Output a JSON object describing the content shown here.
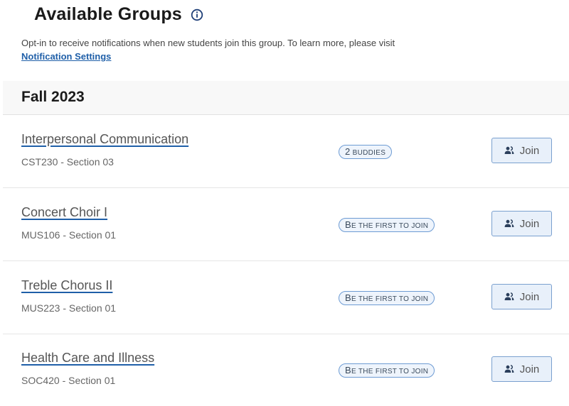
{
  "header": {
    "title": "Available Groups",
    "info_icon": "info-circle-icon",
    "description": "Opt-in to receive notifications when new students join this group. To learn more, please visit",
    "link_label": "Notification Settings"
  },
  "term": {
    "title": "Fall 2023"
  },
  "groups": [
    {
      "name": "Interpersonal Communication",
      "code": "CST230 - Section 03",
      "badge": "2 BUDDIES",
      "badge_type": "buddies",
      "action": "Join",
      "action_icon": "people-icon"
    },
    {
      "name": "Concert Choir I",
      "code": "MUS106 - Section 01",
      "badge": "BE THE FIRST TO JOIN",
      "badge_type": "first",
      "action": "Join",
      "action_icon": "people-icon"
    },
    {
      "name": "Treble Chorus II",
      "code": "MUS223 - Section 01",
      "badge": "BE THE FIRST TO JOIN",
      "badge_type": "first",
      "action": "Join",
      "action_icon": "people-icon"
    },
    {
      "name": "Health Care and Illness",
      "code": "SOC420 - Section 01",
      "badge": "BE THE FIRST TO JOIN",
      "badge_type": "first",
      "action": "Join",
      "action_icon": "people-icon"
    }
  ],
  "colors": {
    "accent": "#1f5fa8",
    "badge_border": "#6d9bd3",
    "button_bg": "#e8f0fa",
    "header_bg": "#f8f8f8"
  }
}
